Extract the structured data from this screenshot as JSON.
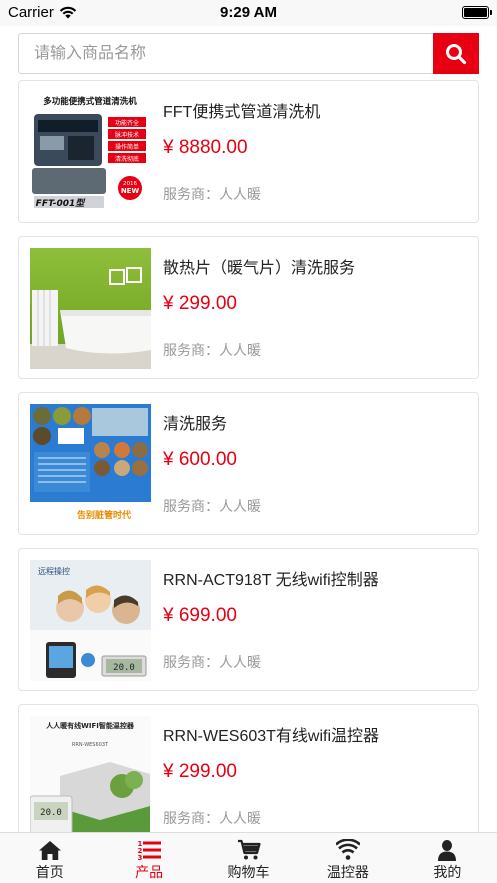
{
  "status_bar": {
    "carrier": "Carrier",
    "time": "9:29 AM"
  },
  "search": {
    "placeholder": "请输入商品名称",
    "value": ""
  },
  "products": [
    {
      "title": "FFT便携式管道清洗机",
      "price": "¥ 8880.00",
      "provider": "服务商：人人暖",
      "image_text": {
        "headline": "多功能便携式管道清洗机",
        "tags": [
          "功能齐全",
          "脉冲技术",
          "操作简单",
          "清洗彻底"
        ],
        "model": "FFT-001型",
        "badge_year": "2016",
        "badge": "NEW"
      }
    },
    {
      "title": "散热片（暖气片）清洗服务",
      "price": "¥ 299.00",
      "provider": "服务商：人人暖"
    },
    {
      "title": "清洗服务",
      "price": "¥ 600.00",
      "provider": "服务商：人人暖",
      "image_text": {
        "slogan": "告别脏管时代"
      }
    },
    {
      "title": "RRN-ACT918T 无线wifi控制器",
      "price": "¥ 699.00",
      "provider": "服务商：人人暖",
      "image_text": {
        "caption": "远程操控",
        "display": "20.0"
      }
    },
    {
      "title": "RRN-WES603T有线wifi温控器",
      "price": "¥ 299.00",
      "provider": "服务商：人人暖",
      "image_text": {
        "headline": "人人暖有线WIFI智能温控器",
        "model": "RRN-WES603T",
        "display": "20.0"
      }
    }
  ],
  "tabs": [
    {
      "label": "首页",
      "icon": "home-icon",
      "active": false
    },
    {
      "label": "产品",
      "icon": "list-icon",
      "active": true
    },
    {
      "label": "购物车",
      "icon": "cart-icon",
      "active": false
    },
    {
      "label": "温控器",
      "icon": "wifi-icon",
      "active": false
    },
    {
      "label": "我的",
      "icon": "user-icon",
      "active": false
    }
  ],
  "colors": {
    "accent": "#e60012",
    "text": "#222222",
    "muted": "#999999",
    "border": "#e3e3e3"
  }
}
